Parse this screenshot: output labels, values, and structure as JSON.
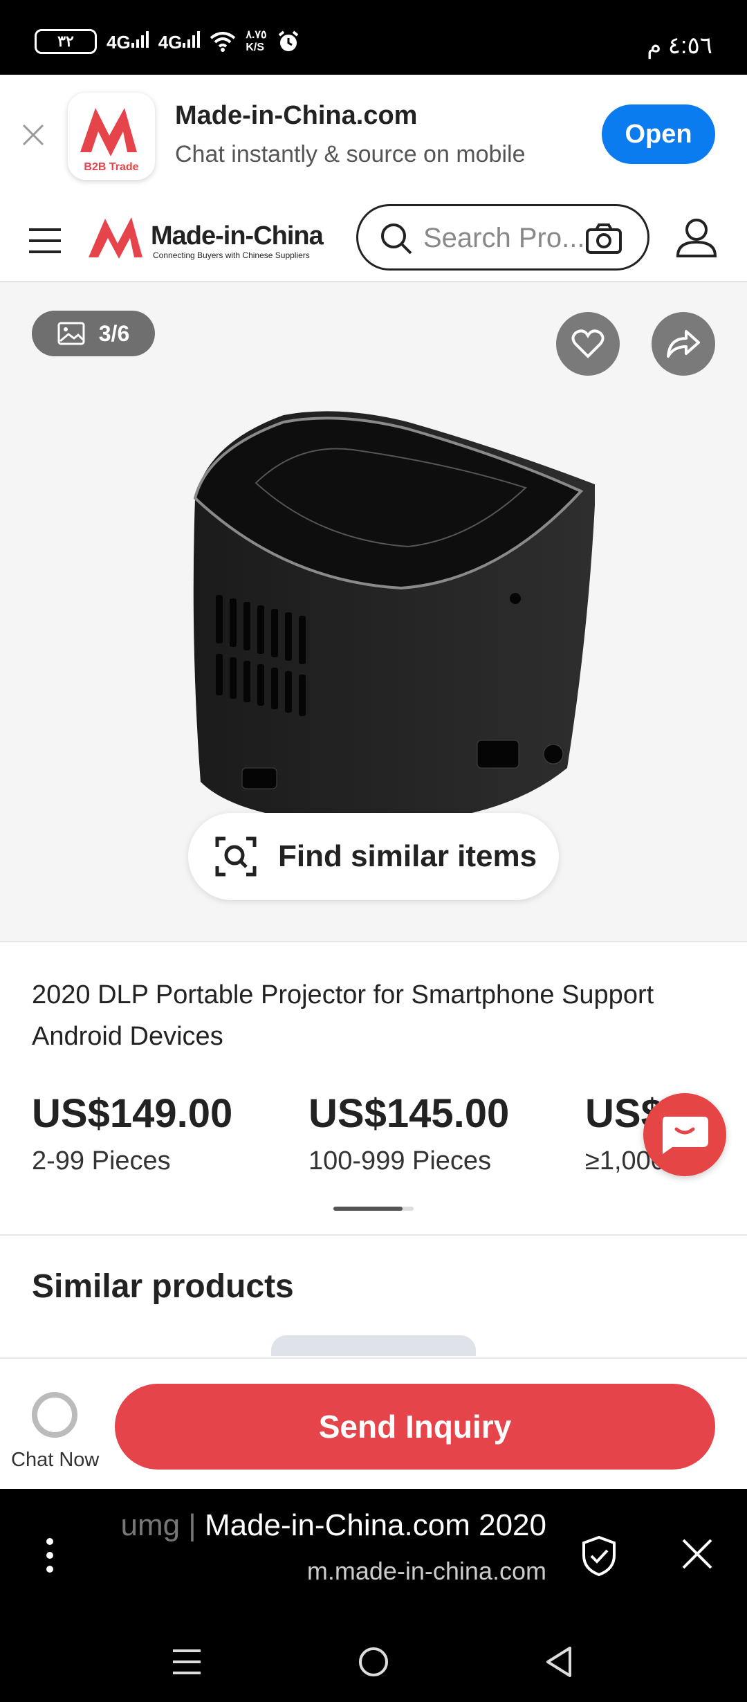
{
  "status_bar": {
    "battery": "٣٢",
    "signal_1": "4G",
    "signal_2": "4G",
    "speed_value": "٨.٧٥",
    "speed_unit": "K/S",
    "time": "٤:٥٦ م"
  },
  "app_banner": {
    "title": "Made-in-China.com",
    "subtitle": "Chat instantly & source on mobile",
    "open_label": "Open",
    "icon_text": "B2B Trade"
  },
  "nav": {
    "logo_text": "Made-in-China",
    "logo_tagline": "Connecting Buyers with Chinese Suppliers",
    "search_placeholder": "Search Pro..."
  },
  "gallery": {
    "counter": "3/6",
    "find_similar_label": "Find similar items"
  },
  "product": {
    "title": "2020 DLP Portable Projector for Smartphone Support Android Devices",
    "prices": [
      {
        "price": "US$149.00",
        "qty": "2-99 Pieces"
      },
      {
        "price": "US$145.00",
        "qty": "100-999 Pieces"
      },
      {
        "price": "US$",
        "qty": "≥1,000"
      }
    ]
  },
  "similar": {
    "heading": "Similar products"
  },
  "action_bar": {
    "chat_now_label": "Chat Now",
    "send_inquiry_label": "Send Inquiry"
  },
  "browser": {
    "page_title_faded": "umg | ",
    "page_title": "Made-in-China.com 2020",
    "url": "m.made-in-china.com"
  },
  "colors": {
    "brand_red": "#e5444a",
    "open_blue": "#0a7cf0"
  }
}
